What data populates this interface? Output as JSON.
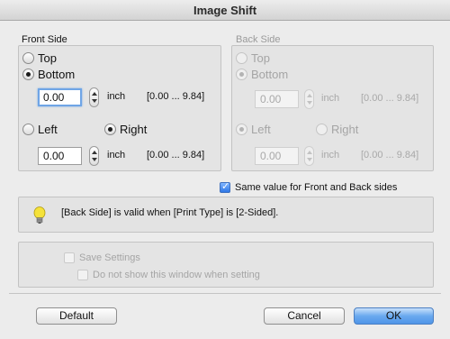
{
  "window": {
    "title": "Image Shift"
  },
  "front": {
    "label": "Front Side",
    "vertical": {
      "top": "Top",
      "bottom": "Bottom",
      "selected": "bottom",
      "value": "0.00",
      "unit": "inch",
      "range": "[0.00 ... 9.84]"
    },
    "horizontal": {
      "left": "Left",
      "right": "Right",
      "selected": "right",
      "value": "0.00",
      "unit": "inch",
      "range": "[0.00 ... 9.84]"
    }
  },
  "back": {
    "label": "Back Side",
    "vertical": {
      "top": "Top",
      "bottom": "Bottom",
      "selected": "bottom",
      "value": "0.00",
      "unit": "inch",
      "range": "[0.00 ... 9.84]"
    },
    "horizontal": {
      "left": "Left",
      "right": "Right",
      "selected": "left",
      "value": "0.00",
      "unit": "inch",
      "range": "[0.00 ... 9.84]"
    }
  },
  "same_value": {
    "label": "Same value for Front and Back sides",
    "checked": true
  },
  "info": {
    "icon": "lightbulb-icon",
    "text": "[Back Side] is valid when [Print Type] is [2-Sided]."
  },
  "settings": {
    "save_label": "Save Settings",
    "save_checked": false,
    "noshow_label": "Do not show this window when setting",
    "noshow_checked": false
  },
  "buttons": {
    "default": "Default",
    "cancel": "Cancel",
    "ok": "OK"
  },
  "colors": {
    "accent": "#4f95e8",
    "disabled_text": "#a5a5a5"
  }
}
